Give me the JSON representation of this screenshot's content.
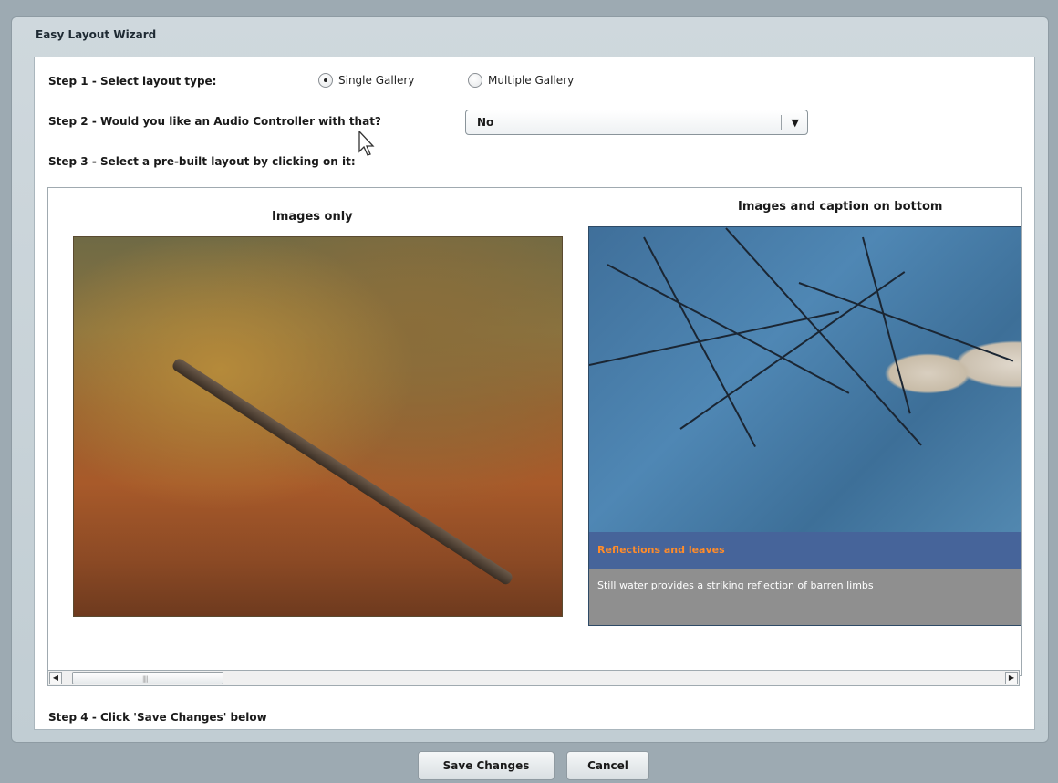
{
  "wizard": {
    "title": "Easy Layout Wizard"
  },
  "step1": {
    "label": "Step 1 - Select layout type:",
    "options": [
      {
        "label": "Single Gallery",
        "selected": true
      },
      {
        "label": "Multiple Gallery",
        "selected": false
      }
    ]
  },
  "step2": {
    "label": "Step 2 - Would you like an Audio Controller with that?",
    "dropdown_value": "No"
  },
  "step3": {
    "label": "Step 3 - Select a pre-built layout by clicking on it:"
  },
  "layouts": [
    {
      "title": "Images only"
    },
    {
      "title": "Images and caption on bottom",
      "caption_title": "Reflections and leaves",
      "caption_text": "Still water provides a striking reflection of barren limbs"
    }
  ],
  "step4": {
    "label": "Step 4 - Click 'Save Changes' below"
  },
  "buttons": {
    "save": "Save Changes",
    "cancel": "Cancel"
  },
  "colors": {
    "caption_title": "#ff8c2a",
    "caption_bar": "#46649a",
    "caption_body": "#8f8f8f"
  }
}
